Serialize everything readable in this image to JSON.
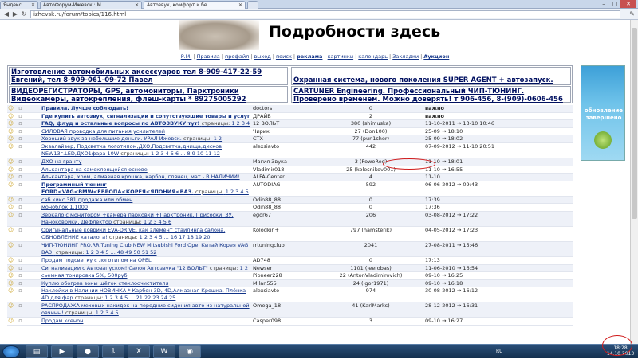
{
  "browser": {
    "tabs": [
      {
        "label": "Яндекс"
      },
      {
        "label": "АвтоФорум-Ижевск : М..."
      },
      {
        "label": "Автозвук, комфорт и бе..."
      },
      {
        "label": ""
      }
    ],
    "url": "izhevsk.ru/forum/topics/116.html",
    "controls": {
      "min": "–",
      "max": "□",
      "close": "✕"
    }
  },
  "banner": {
    "text": "Подробности здесь"
  },
  "menu": {
    "items": [
      {
        "label": "Р.М.",
        "bold": false
      },
      {
        "label": "Правила",
        "bold": false
      },
      {
        "label": "профайл",
        "bold": false
      },
      {
        "label": "выход",
        "bold": false
      },
      {
        "label": "поиск",
        "bold": false
      },
      {
        "label": "реклама",
        "bold": true
      },
      {
        "label": "картинки",
        "bold": false
      },
      {
        "label": "календарь",
        "bold": false
      },
      {
        "label": "Закладки",
        "bold": false
      },
      {
        "label": "Аукцион",
        "bold": true
      }
    ]
  },
  "ads": {
    "left_top": "Изготовление автомобильных аксессуаров тел 8-909-417-22-59 Евгений, тел 8-909-061-09-72 Павел",
    "right_top": "Охранная система, нового поколения SUPER AGENT + автозапуск.",
    "left_bottom": "ВИДЕОРЕГИСТРАТОРЫ, GPS, автомониторы, Парктроники Видеокамеры, автокрепления, флеш-карты * 89275005292",
    "right_bottom": "CARTUNER Engineering. Профессиональный ЧИП-ТЮНИНГ. Проверено временем. Можно доверять! т 906-456, 8-(909)-0606-456"
  },
  "side_ad": {
    "text": "обновление завершено"
  },
  "pages_label": "страницы:",
  "topics": [
    {
      "title": "Правила. Лучше соблюдать!",
      "bold": true,
      "pages": "",
      "author": "doctors",
      "replies": "0",
      "last": "важно",
      "last_bold": true,
      "hl": true
    },
    {
      "title": "Где купить автозвук, сигнализации и сопутствующие товары и услуги в Ижевске",
      "bold": true,
      "pages": "",
      "author": "ДРАЙВ",
      "replies": "2",
      "last": "важно",
      "last_bold": true,
      "hl": false
    },
    {
      "title": "FAQ, флуд и остальные вопросы по АВТОЗВУКУ тут!",
      "bold": true,
      "pages": "1 2 3 4 5 6 7 8 9 10 11 12 13 14 15 16",
      "author": "12 ВОЛЬТ",
      "replies": "380 (shimuska)",
      "last": "11-10-2011 → 13-10 10:46",
      "last_bold": false,
      "hl": true
    },
    {
      "title": "СИЛОВАЯ проводка для питания усилителей",
      "bold": false,
      "pages": "",
      "author": "Чирик",
      "replies": "27 (Don100)",
      "last": "25-09 → 18:10",
      "last_bold": false,
      "hl": false
    },
    {
      "title": "Хороший звук за небольшие деньги. УРАЛ Ижевск.",
      "bold": false,
      "pages": "1 2",
      "author": "СТХ",
      "replies": "77 (pun1sher)",
      "last": "25-09 → 18:02",
      "last_bold": false,
      "hl": true
    },
    {
      "title": "Эквалайзер, Подсветка логотипом,ДХО,Подсветка,днища,дисков NEW13г.LED,ДХО1фара 10W",
      "bold": false,
      "pages": "1 2 3 4 5 6 ... 8 9 10 11 12",
      "author": "alexsiavto",
      "replies": "442",
      "last": "07-09-2012 → 11-10 20:51",
      "last_bold": false,
      "hl": false,
      "tall": true
    },
    {
      "title": "ДХО на гранту",
      "bold": false,
      "pages": "",
      "author": "Магия Звука",
      "replies": "3 (PoweRed)",
      "last": "11-10 → 18:01",
      "last_bold": false,
      "hl": true
    },
    {
      "title": "Алькантара на самоклеящейся основе",
      "bold": false,
      "pages": "",
      "author": "Vladimir018",
      "replies": "25 (kolesnikov001)",
      "last": "11-10 → 16:55",
      "last_bold": false,
      "hl": false
    },
    {
      "title": "Алькантара, хром, алмазная крошка, карбон, глянец, мат - В НАЛИЧИИ!",
      "bold": false,
      "pages": "",
      "author": "ALFA-Center",
      "replies": "4",
      "last": "11-10",
      "last_bold": false,
      "hl": true
    },
    {
      "title": "Программный тюнинг FORD<VAG<BMW<ЕВРОПА<КОРЕЯ<ЯПОНИЯ<ВАЗ.",
      "bold": true,
      "pages": "1 2 3 4 5 ... 25 26 27",
      "author": "AUTODIAG",
      "replies": "592",
      "last": "06-06-2012 → 09:43",
      "last_bold": false,
      "hl": false,
      "tall": true
    },
    {
      "title": "саб кикс 381 продажа или обмен",
      "bold": false,
      "pages": "",
      "author": "Odin88_88",
      "replies": "0",
      "last": "17:39",
      "last_bold": false,
      "hl": true
    },
    {
      "title": "моноблок 1.1000",
      "bold": false,
      "pages": "",
      "author": "Odin88_88",
      "replies": "0",
      "last": "17:36",
      "last_bold": false,
      "hl": false
    },
    {
      "title": "Зеркало с монитором +камера парковки +Парктроник, Присоски, ЗУ, Наноковрики, Дефлектор",
      "bold": false,
      "pages": "1 2 3 4 5 6",
      "author": "egor67",
      "replies": "206",
      "last": "03-08-2012 → 17:22",
      "last_bold": false,
      "hl": true,
      "tall": true
    },
    {
      "title": "Оригинальные коврики EVA-DRIVE, как элемент стайлинга салона. ОБНОВЛЕНИЕ каталога!",
      "bold": false,
      "pages": "1 2 3 4 5 ... 16 17 18 19 20",
      "author": "Kolodkin+",
      "replies": "797 (hamsterik)",
      "last": "04-05-2012 → 17:23",
      "last_bold": false,
      "hl": false,
      "tall": true
    },
    {
      "title": "ЧИП-ТЮНИНГ PRO.RR Tuning Club.NEW Mitsubishi Ford Opel Китай Корея VAG ВАЗ!",
      "bold": false,
      "pages": "1 2 3 4 5 ... 48 49 50 51 52",
      "author": "rrtuningclub",
      "replies": "2041",
      "last": "27-08-2011 → 15:46",
      "last_bold": false,
      "hl": true,
      "tall": true
    },
    {
      "title": "Продам подсветку с логотипом на OPEL",
      "bold": false,
      "pages": "",
      "author": "AD748",
      "replies": "0",
      "last": "17:13",
      "last_bold": false,
      "hl": false
    },
    {
      "title": "Сигнализации с Автозапуском! Салон Автозвука \"12 ВОЛЬТ\"",
      "bold": false,
      "pages": "1 2 3 4 5 ... 24 25 26 27 28",
      "author": "Newser",
      "replies": "1101 (jeerobas)",
      "last": "11-06-2010 → 16:54",
      "last_bold": false,
      "hl": true
    },
    {
      "title": "сьемная тонировка 5%, 500руб",
      "bold": false,
      "pages": "",
      "author": "Pioneer228",
      "replies": "22 (AntonVladimirovich)",
      "last": "09-10 → 16:25",
      "last_bold": false,
      "hl": false
    },
    {
      "title": "Куплю обогрев зоны щёток стеклоочистителя",
      "bold": false,
      "pages": "",
      "author": "Milan555",
      "replies": "24 (igor1971)",
      "last": "09-10 → 16:18",
      "last_bold": false,
      "hl": true
    },
    {
      "title": "Наклейки в Наличии НОВИНКА * Карбон 3D, 4D,Алмазная Крошка, Плёнка 4D для фар",
      "bold": false,
      "pages": "1 2 3 4 5 ... 21 22 23 24 25",
      "author": "alexsiavto",
      "replies": "974",
      "last": "30-08-2012 → 16:12",
      "last_bold": false,
      "hl": false,
      "tall": true
    },
    {
      "title": "РАСПРОДАЖА меховых накидок на передние сидения авто из натуральной овчины!",
      "bold": false,
      "pages": "1 2 3 4 5",
      "author": "Omega_18",
      "replies": "41 (KarlMarks)",
      "last": "28-12-2012 → 16:31",
      "last_bold": false,
      "hl": true,
      "tall": true
    },
    {
      "title": "Продам ксенон",
      "bold": false,
      "pages": "",
      "author": "Casper098",
      "replies": "3",
      "last": "09-10 → 16:27",
      "last_bold": false,
      "hl": false
    }
  ],
  "taskbar": {
    "lang": "RU",
    "time": "18:28",
    "date": "14.10.2013"
  },
  "colors": {
    "link": "#113388",
    "annotation": "#d01a1a",
    "taskbar": "#1d3d62"
  }
}
